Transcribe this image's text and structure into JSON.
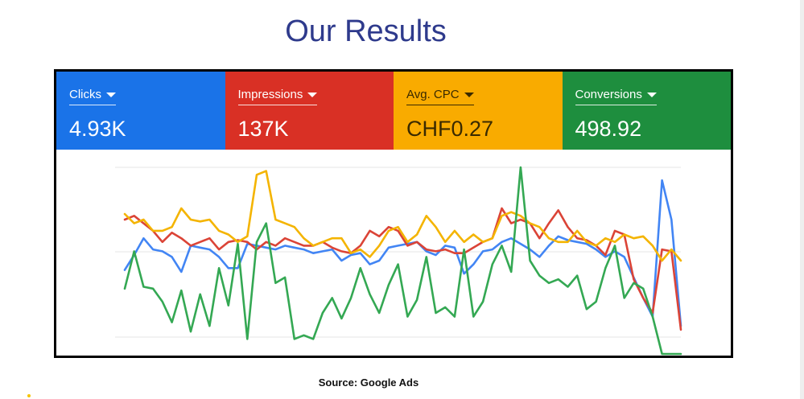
{
  "title": "Our Results",
  "source": "Source: Google Ads",
  "metrics": [
    {
      "label": "Clicks",
      "value": "4.93K",
      "color": "#1a73e8",
      "text_tone": "light"
    },
    {
      "label": "Impressions",
      "value": "137K",
      "color": "#d93025",
      "text_tone": "light"
    },
    {
      "label": "Avg. CPC",
      "value": "CHF0.27",
      "color": "#f9ab00",
      "text_tone": "dark"
    },
    {
      "label": "Conversions",
      "value": "498.92",
      "color": "#1e8e3e",
      "text_tone": "light"
    }
  ],
  "chart_data": {
    "type": "line",
    "x": [
      1,
      2,
      3,
      4,
      5,
      6,
      7,
      8,
      9,
      10,
      11,
      12,
      13,
      14,
      15,
      16,
      17,
      18,
      19,
      20,
      21,
      22,
      23,
      24,
      25,
      26,
      27,
      28,
      29,
      30,
      31,
      32,
      33,
      34,
      35,
      36,
      37,
      38,
      39,
      40,
      41,
      42,
      43,
      44,
      45,
      46,
      47,
      48,
      49,
      50,
      51,
      52,
      53,
      54,
      55,
      56,
      57,
      58,
      59,
      60
    ],
    "ylim": [
      0,
      1
    ],
    "grid": true,
    "series": [
      {
        "color": "#4285f4",
        "values": [
          0.45,
          0.53,
          0.62,
          0.56,
          0.55,
          0.52,
          0.44,
          0.58,
          0.57,
          0.56,
          0.52,
          0.46,
          0.46,
          0.59,
          0.58,
          0.57,
          0.56,
          0.58,
          0.57,
          0.56,
          0.54,
          0.55,
          0.56,
          0.5,
          0.53,
          0.54,
          0.48,
          0.5,
          0.57,
          0.58,
          0.59,
          0.6,
          0.55,
          0.53,
          0.58,
          0.57,
          0.43,
          0.48,
          0.55,
          0.56,
          0.6,
          0.62,
          0.59,
          0.56,
          0.52,
          0.58,
          0.63,
          0.61,
          0.6,
          0.59,
          0.56,
          0.52,
          0.55,
          0.52,
          0.41,
          0.3,
          0.2,
          0.93,
          0.72,
          0.15
        ]
      },
      {
        "color": "#db4437",
        "values": [
          0.72,
          0.74,
          0.7,
          0.66,
          0.6,
          0.65,
          0.62,
          0.58,
          0.6,
          0.62,
          0.56,
          0.6,
          0.61,
          0.6,
          0.56,
          0.6,
          0.58,
          0.62,
          0.6,
          0.58,
          0.58,
          0.6,
          0.57,
          0.55,
          0.54,
          0.58,
          0.66,
          0.63,
          0.68,
          0.66,
          0.58,
          0.6,
          0.56,
          0.55,
          0.56,
          0.54,
          0.54,
          0.57,
          0.6,
          0.62,
          0.78,
          0.7,
          0.72,
          0.7,
          0.62,
          0.7,
          0.77,
          0.68,
          0.62,
          0.61,
          0.58,
          0.53,
          0.66,
          0.64,
          0.4,
          0.3,
          0.22,
          0.56,
          0.55,
          0.13
        ]
      },
      {
        "color": "#f4b400",
        "values": [
          0.75,
          0.7,
          0.72,
          0.66,
          0.66,
          0.68,
          0.78,
          0.72,
          0.71,
          0.72,
          0.66,
          0.64,
          0.6,
          0.63,
          0.96,
          0.98,
          0.72,
          0.7,
          0.68,
          0.62,
          0.58,
          0.6,
          0.62,
          0.62,
          0.54,
          0.56,
          0.52,
          0.58,
          0.66,
          0.68,
          0.6,
          0.64,
          0.74,
          0.68,
          0.6,
          0.66,
          0.6,
          0.64,
          0.6,
          0.62,
          0.74,
          0.76,
          0.74,
          0.7,
          0.68,
          0.62,
          0.6,
          0.6,
          0.66,
          0.6,
          0.58,
          0.62,
          0.6,
          0.64,
          0.62,
          0.63,
          0.58,
          0.5,
          0.56,
          0.5
        ]
      },
      {
        "color": "#34a853",
        "values": [
          0.35,
          0.55,
          0.36,
          0.35,
          0.28,
          0.17,
          0.34,
          0.12,
          0.32,
          0.15,
          0.46,
          0.26,
          0.59,
          0.08,
          0.6,
          0.7,
          0.38,
          0.41,
          0.08,
          0.1,
          0.08,
          0.22,
          0.3,
          0.19,
          0.3,
          0.46,
          0.32,
          0.22,
          0.37,
          0.48,
          0.2,
          0.29,
          0.52,
          0.22,
          0.25,
          0.2,
          0.56,
          0.2,
          0.28,
          0.48,
          0.58,
          0.44,
          1.0,
          0.5,
          0.42,
          0.38,
          0.4,
          0.36,
          0.42,
          0.24,
          0.28,
          0.46,
          0.58,
          0.3,
          0.38,
          0.35,
          0.2,
          0.0,
          0.0,
          0.0
        ]
      }
    ]
  }
}
